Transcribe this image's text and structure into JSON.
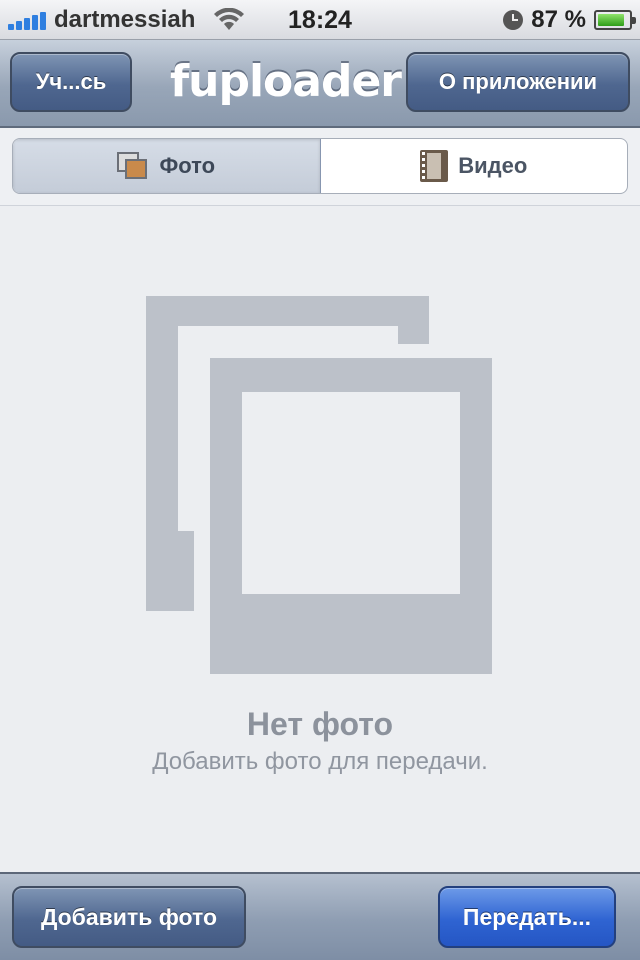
{
  "status_bar": {
    "carrier": "dartmessiah",
    "time": "18:24",
    "battery_percent": "87 %",
    "battery_level": 0.87,
    "icons": [
      "signal-icon",
      "wifi-icon",
      "clock-icon",
      "battery-icon"
    ]
  },
  "nav": {
    "left_button": "Уч...сь",
    "title": "fuploader",
    "right_button": "О приложении"
  },
  "segments": {
    "photo_label": "Фото",
    "video_label": "Видео",
    "selected": "photo"
  },
  "empty_state": {
    "title": "Нет фото",
    "subtitle": "Добавить фото для передачи."
  },
  "toolbar": {
    "add_button": "Добавить фото",
    "send_button": "Передать..."
  },
  "colors": {
    "accent_blue": "#2f64d2",
    "nav_button": "#4f6790",
    "placeholder_gray": "#bcc1c9"
  }
}
